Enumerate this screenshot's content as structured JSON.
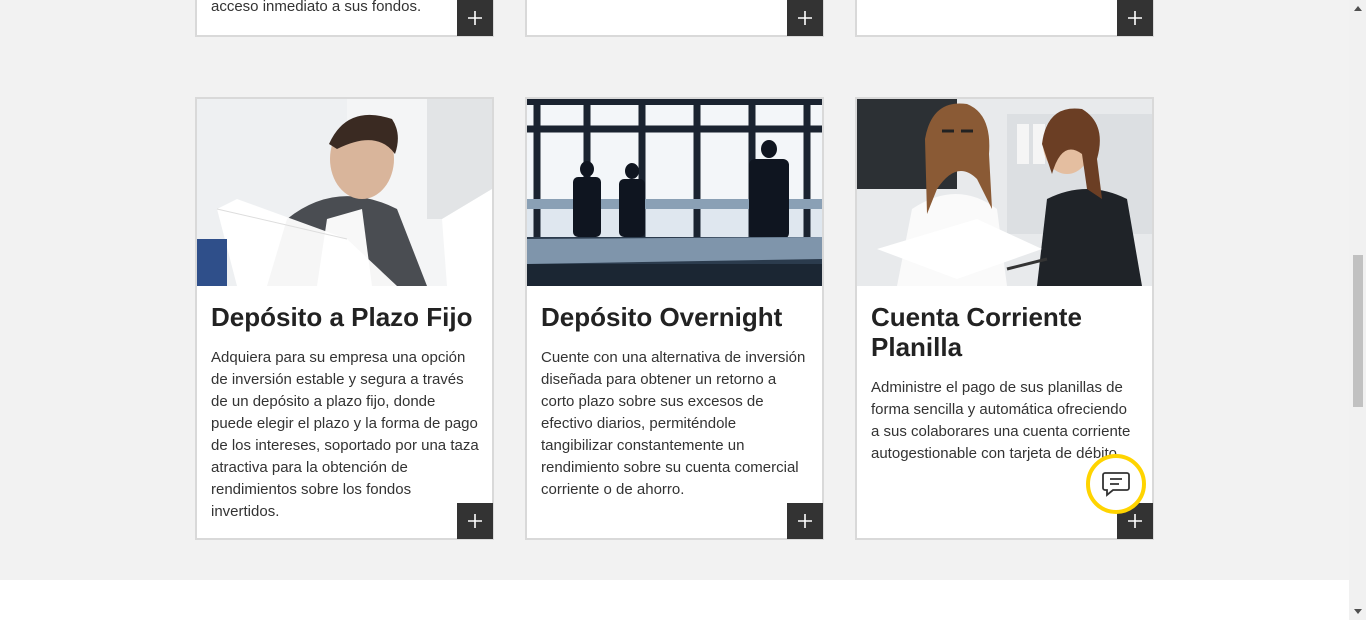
{
  "top_cards": [
    {
      "snippet": "acceso inmediato a sus fondos.",
      "expand_label": "+"
    },
    {
      "snippet": "",
      "expand_label": "+"
    },
    {
      "snippet": "",
      "expand_label": "+"
    }
  ],
  "cards": [
    {
      "title": "Depósito a Plazo Fijo",
      "description": "Adquiera para su empresa una opción de inversión estable y segura a través de un depósito a plazo fijo, donde puede elegir el plazo y la forma de pago de los intereses, soportado por una taza atractiva para la obtención de rendimientos sobre los fondos invertidos.",
      "image": "businessman-reading-document-photo"
    },
    {
      "title": "Depósito Overnight",
      "description": "Cuente con una alternativa de inversión diseñada para obtener un retorno a corto plazo sobre sus excesos de efectivo diarios, permiténdole tangibilizar constantemente un rendimiento sobre su cuenta comercial corriente o de ahorro.",
      "image": "business-silhouettes-office-photo"
    },
    {
      "title": "Cuenta Corriente Planilla",
      "description": "Administre el pago de sus planillas de forma sencilla y automática ofreciendo a sus colaborares una cuenta corriente autogestionable con tarjeta de débito.",
      "image": "two-women-reviewing-papers-photo"
    }
  ],
  "chat": {
    "icon": "chat-icon",
    "accent": "#ffd400"
  },
  "colors": {
    "button_bg": "#333333",
    "card_border": "#d9d9d9",
    "page_bg": "#f2f2f2"
  }
}
